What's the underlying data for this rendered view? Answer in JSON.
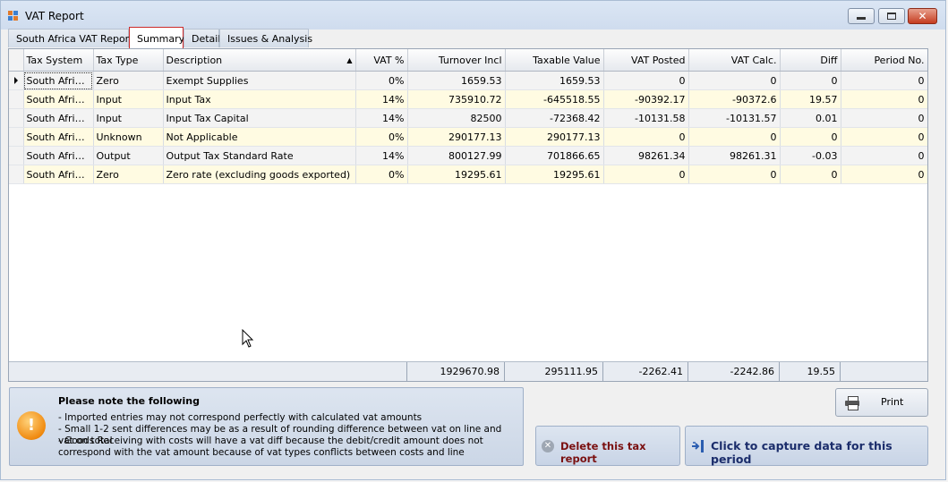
{
  "window": {
    "title": "VAT Report",
    "minimize": "–",
    "maximize": "□",
    "close": "✕"
  },
  "tabs": [
    {
      "label": "South Africa VAT Report"
    },
    {
      "label": "Summary"
    },
    {
      "label": "Detail"
    },
    {
      "label": "Issues & Analysis"
    }
  ],
  "grid": {
    "columns": [
      "Tax System",
      "Tax Type",
      "Description",
      "VAT %",
      "Turnover Incl",
      "Taxable Value",
      "VAT Posted",
      "VAT Calc.",
      "Diff",
      "Period No."
    ],
    "sorted_column": "Description",
    "rows": [
      [
        "South Africa...",
        "Zero",
        "Exempt Supplies",
        "0%",
        "1659.53",
        "1659.53",
        "0",
        "0",
        "0",
        "0"
      ],
      [
        "South Africa...",
        "Input",
        "Input Tax",
        "14%",
        "735910.72",
        "-645518.55",
        "-90392.17",
        "-90372.6",
        "19.57",
        "0"
      ],
      [
        "South Africa...",
        "Input",
        "Input Tax Capital",
        "14%",
        "82500",
        "-72368.42",
        "-10131.58",
        "-10131.57",
        "0.01",
        "0"
      ],
      [
        "South Africa...",
        "Unknown",
        "Not Applicable",
        "0%",
        "290177.13",
        "290177.13",
        "0",
        "0",
        "0",
        "0"
      ],
      [
        "South Africa...",
        "Output",
        "Output Tax Standard Rate",
        "14%",
        "800127.99",
        "701866.65",
        "98261.34",
        "98261.31",
        "-0.03",
        "0"
      ],
      [
        "South Africa...",
        "Zero",
        "Zero rate (excluding goods exported)",
        "0%",
        "19295.61",
        "19295.61",
        "0",
        "0",
        "0",
        "0"
      ]
    ],
    "totals": {
      "turnover_incl": "1929670.98",
      "taxable_value": "295111.95",
      "vat_posted": "-2262.41",
      "vat_calc": "-2242.86",
      "diff": "19.55"
    }
  },
  "note": {
    "title": "Please note the following",
    "lines": [
      "- Imported entries may not correspond perfectly with calculated vat amounts",
      "- Small 1-2 sent differences may be as a result of rounding difference between vat on line and vat on total",
      "- Goods Receiving with costs will have a vat diff because the debit/credit amount does not correspond with the vat amount because of vat types conflicts between costs and line"
    ],
    "icon": "warning-icon",
    "icon_glyph": "!"
  },
  "buttons": {
    "print": "Print",
    "delete": "Delete this tax report",
    "capture": "Click to capture data for this period"
  },
  "colors": {
    "odd_row": "#fffbe2",
    "even_row": "#f3f3f3",
    "active_tab_border": "#cc2b2b",
    "delete_text": "#7a1010",
    "capture_text": "#1b2d6b"
  }
}
